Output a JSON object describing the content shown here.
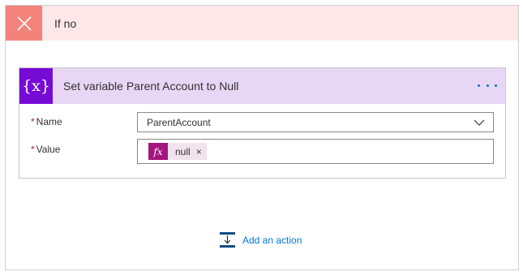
{
  "branch": {
    "title": "If no",
    "icon": "close-icon",
    "color": "#f3837a",
    "bg": "#fde7e9"
  },
  "action": {
    "title": "Set variable Parent Account to Null",
    "icon": "variable-icon",
    "icon_glyph": "{x}",
    "accent": "#770bd6",
    "header_bg": "#e7d7f5",
    "more_menu": "more-options-icon"
  },
  "fields": {
    "name": {
      "required_mark": "*",
      "label": "Name",
      "value": "ParentAccount"
    },
    "value": {
      "required_mark": "*",
      "label": "Value",
      "token": {
        "icon_glyph": "fx",
        "text": "null",
        "remove": "×",
        "color": "#a4157f"
      }
    }
  },
  "add_action": {
    "label": "Add an action",
    "icon": "add-action-icon",
    "color": "#0078d4"
  }
}
